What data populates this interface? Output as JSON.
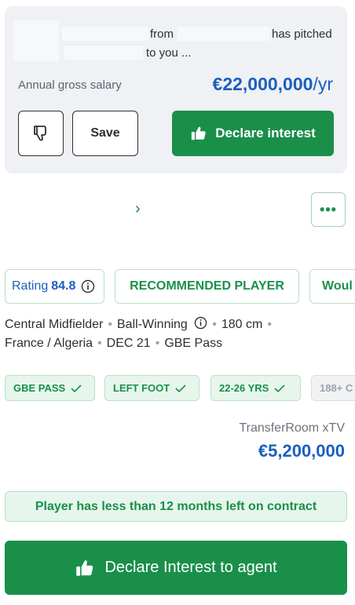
{
  "pitch": {
    "from_text": "from",
    "pitched_text": "has pitched",
    "to_you_text": "to you ...",
    "salary_label": "Annual gross salary",
    "salary_amount": "€22,000,000",
    "salary_unit": "/yr",
    "save_label": "Save",
    "declare_label": "Declare interest"
  },
  "nav": {
    "chevron": "›",
    "more": "•••"
  },
  "chips": {
    "rating_label": "Rating",
    "rating_value": "84.8",
    "recommended": "RECOMMENDED PLAYER",
    "partial": "Woul"
  },
  "player": {
    "position": "Central Midfielder",
    "role": "Ball-Winning",
    "height": "180 cm",
    "nationality": "France / Algeria",
    "dob": "DEC 21",
    "gbe": "GBE Pass"
  },
  "tags": [
    "GBE PASS",
    "LEFT FOOT",
    "22-26 YRS",
    "188+ C"
  ],
  "xtv": {
    "label": "TransferRoom xTV",
    "value": "€5,200,000"
  },
  "contract_note": "Player has less than 12 months left on contract",
  "cta_label": "Declare Interest to agent",
  "colors": {
    "green": "#1a8f4a",
    "blue": "#1a5fbf",
    "card": "#eff1f4"
  }
}
